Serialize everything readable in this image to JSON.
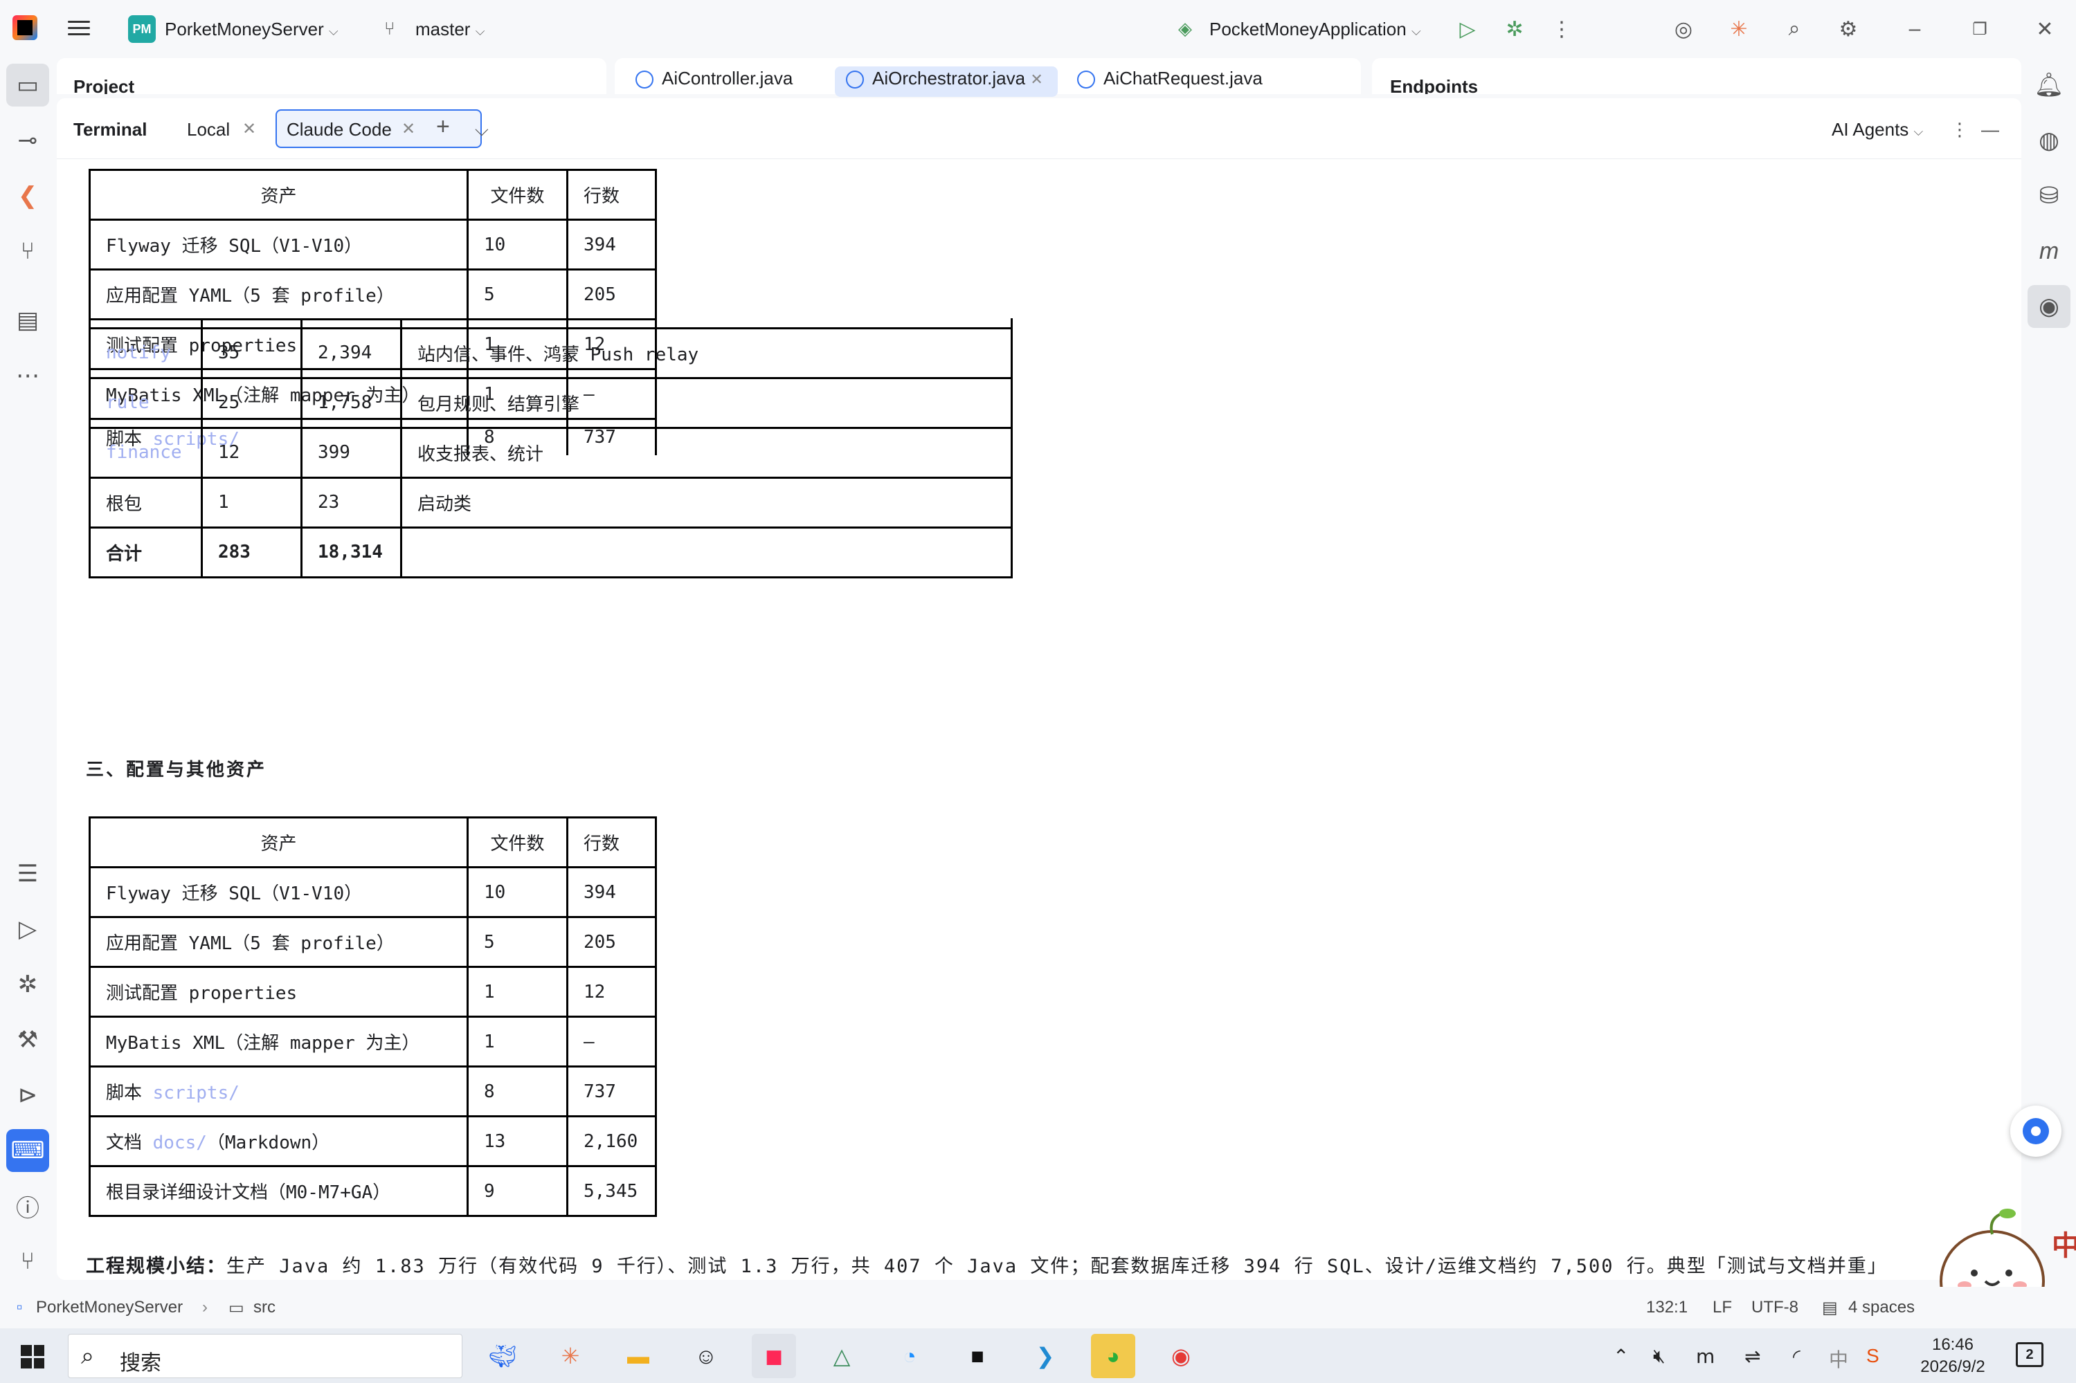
{
  "titlebar": {
    "project_badge": "PM",
    "project_name": "PorketMoneyServer",
    "branch": "master",
    "run_config": "PocketMoneyApplication"
  },
  "upper_panels": {
    "project_label": "Project",
    "endpoints_label": "Endpoints",
    "editor_tabs": [
      "AiController.java",
      "AiOrchestrator.java",
      "AiChatRequest.java"
    ]
  },
  "terminal": {
    "title": "Terminal",
    "tabs": [
      "Local",
      "Claude Code"
    ],
    "agents_label": "AI Agents"
  },
  "table_top": {
    "headers": [
      "资产",
      "文件数",
      "行数"
    ],
    "rows": [
      [
        "Flyway 迁移 SQL（V1-V10）",
        "10",
        "394"
      ],
      [
        "应用配置 YAML（5 套 profile）",
        "5",
        "205"
      ],
      [
        "测试配置 properties",
        "1",
        "12"
      ],
      [
        "MyBatis XML（注解 mapper 为主）",
        "1",
        "—"
      ]
    ],
    "script_row": {
      "prefix": "脚本 ",
      "link": "scripts/",
      "files": "8",
      "lines": "737"
    }
  },
  "table_modules": {
    "rows": [
      {
        "name": "notify",
        "link": true,
        "files": "35",
        "lines": "2,394",
        "desc": "站内信、事件、鸿蒙 Push relay"
      },
      {
        "name": "rule",
        "link": true,
        "files": "25",
        "lines": "1,758",
        "desc": "包月规则、结算引擎"
      },
      {
        "name": "finance",
        "link": true,
        "files": "12",
        "lines": "399",
        "desc": "收支报表、统计"
      },
      {
        "name": "根包",
        "link": false,
        "files": "1",
        "lines": "23",
        "desc": "启动类"
      }
    ],
    "total": {
      "name": "合计",
      "files": "283",
      "lines": "18,314"
    }
  },
  "section3_title": "三、配置与其他资产",
  "table_config": {
    "headers": [
      "资产",
      "文件数",
      "行数"
    ],
    "rows": [
      [
        "Flyway 迁移 SQL（V1-V10）",
        "10",
        "394"
      ],
      [
        "应用配置 YAML（5 套 profile）",
        "5",
        "205"
      ],
      [
        "测试配置 properties",
        "1",
        "12"
      ],
      [
        "MyBatis XML（注解 mapper 为主）",
        "1",
        "—"
      ]
    ],
    "script_row": {
      "prefix": "脚本 ",
      "link": "scripts/",
      "files": "8",
      "lines": "737"
    },
    "docs_row": {
      "prefix": "文档 ",
      "link": "docs/",
      "suffix": "（Markdown）",
      "files": "13",
      "lines": "2,160"
    },
    "design_row": [
      "根目录详细设计文档（M0-M7+GA）",
      "9",
      "5,345"
    ]
  },
  "summary": {
    "label": "工程规模小结：",
    "text": "生产 Java 约 1.83 万行（有效代码 9 千行）、测试 1.3 万行，共 407 个 Java 文件；配套数据库迁移 394 行 SQL、设计/运维文档约 7,500 行。典型「测试与文档并重」"
  },
  "statusbar": {
    "breadcrumb_project": "PorketMoneyServer",
    "breadcrumb_folder": "src",
    "position": "132:1",
    "line_ending": "LF",
    "encoding": "UTF-8",
    "indent": "4 spaces"
  },
  "taskbar": {
    "search_placeholder": "搜索",
    "time": "16:46",
    "date": "2026/9/2",
    "notification_count": "2",
    "ime_label": "中"
  },
  "colors": {
    "accent": "#3574f0",
    "link": "#a0aef0",
    "panel_bg": "#ffffff",
    "chrome_bg": "#f7f8fa"
  }
}
